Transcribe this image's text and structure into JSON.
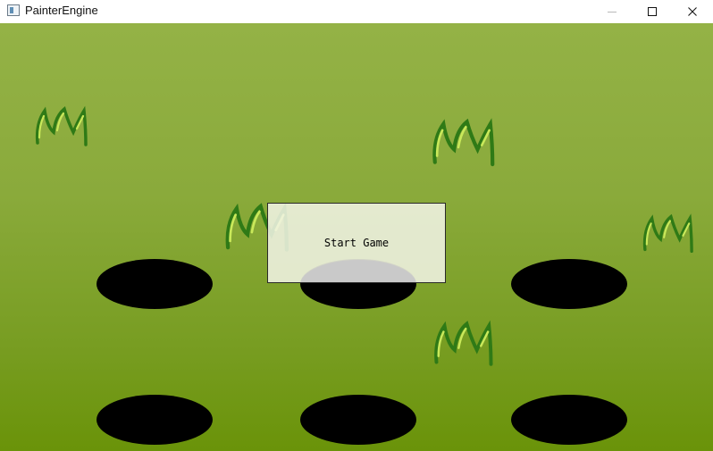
{
  "window": {
    "title": "PainterEngine",
    "icon": "app-window-icon",
    "controls": [
      "minimize-icon",
      "maximize-icon",
      "close-icon"
    ]
  },
  "game": {
    "background_top": "#94b246",
    "background_bottom": "#6a9309",
    "hole_color": "#000000",
    "grass_dark": "#2f7a16",
    "grass_light": "#c9e95a",
    "holes_rows": 2,
    "holes_cols": 3,
    "start_button_label": "Start Game"
  }
}
